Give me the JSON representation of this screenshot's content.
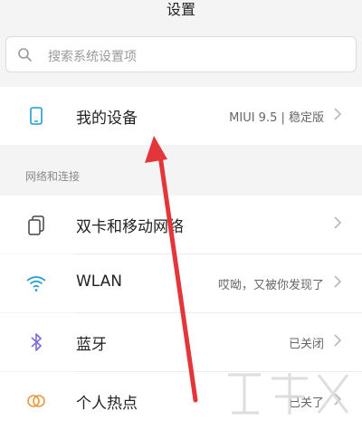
{
  "header": {
    "title": "设置"
  },
  "search": {
    "placeholder": "搜索系统设置项"
  },
  "device": {
    "label": "我的设备",
    "value": "MIUI 9.5 | 稳定版"
  },
  "sections": {
    "network_title": "网络和连接"
  },
  "items": [
    {
      "label": "双卡和移动网络",
      "value": ""
    },
    {
      "label": "WLAN",
      "value": "哎呦，又被你发现了"
    },
    {
      "label": "蓝牙",
      "value": "已关闭"
    },
    {
      "label": "个人热点",
      "value": "已关了"
    }
  ],
  "colors": {
    "accent": "#1e9bd0",
    "arrow": "#e2363a"
  },
  "icons": [
    "search-icon",
    "phone-icon",
    "sim-icon",
    "wifi-icon",
    "bluetooth-icon",
    "hotspot-icon",
    "chevron-right-icon"
  ]
}
